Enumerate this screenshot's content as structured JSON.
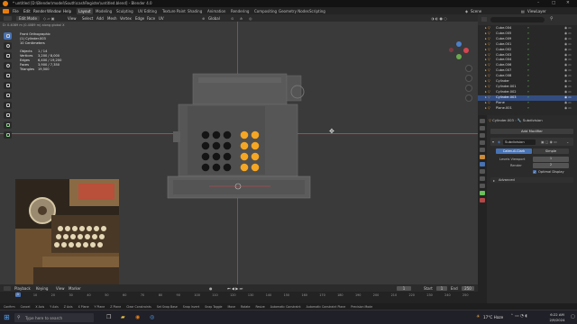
{
  "app": {
    "title": "* untitled [D:\\Blender\\model\\South\\cashRegister\\untitled.blend] - Blender 4.0",
    "window_controls": [
      "–",
      "□",
      "✕"
    ]
  },
  "menu": {
    "items": [
      "File",
      "Edit",
      "Render",
      "Window",
      "Help"
    ],
    "workspaces": [
      "Layout",
      "Modeling",
      "Sculpting",
      "UV Editing",
      "Texture Paint",
      "Shading",
      "Animation",
      "Rendering",
      "Compositing",
      "Geometry Nodes",
      "Scripting"
    ],
    "active_workspace": "Layout",
    "scene": "Scene",
    "view_layer": "ViewLayer"
  },
  "tool_header": {
    "mode": "Edit Mode",
    "menus": [
      "View",
      "Select",
      "Add",
      "Mesh",
      "Vertex",
      "Edge",
      "Face",
      "UV"
    ],
    "transform_orientation": "Global"
  },
  "viewport": {
    "header_status": "D: 0.4089 m (0.4089 m) along global X",
    "view_name": "Front Orthographic",
    "object_name": "(1) Cylinder.003",
    "units": "10 Centimeters",
    "stats": [
      {
        "label": "Objects",
        "value": "1 / 14"
      },
      {
        "label": "Vertices",
        "value": "3,200 / 8,000"
      },
      {
        "label": "Edges",
        "value": "6,400 / 19,200"
      },
      {
        "label": "Faces",
        "value": "3,900 / 7,350"
      },
      {
        "label": "Triangles",
        "value": "19,500"
      }
    ]
  },
  "outliner": {
    "items": [
      {
        "name": "Cube.004",
        "selected": false
      },
      {
        "name": "Cube.005",
        "selected": false
      },
      {
        "name": "Cube.009",
        "selected": false
      },
      {
        "name": "Cube.001",
        "selected": false
      },
      {
        "name": "Cube.002",
        "selected": false
      },
      {
        "name": "Cube.003",
        "selected": false
      },
      {
        "name": "Cube.004",
        "selected": false
      },
      {
        "name": "Cube.006",
        "selected": false
      },
      {
        "name": "Cube.007",
        "selected": false
      },
      {
        "name": "Cube.008",
        "selected": false
      },
      {
        "name": "Cylinder",
        "selected": false
      },
      {
        "name": "Cylinder.001",
        "selected": false
      },
      {
        "name": "Cylinder.002",
        "selected": false
      },
      {
        "name": "Cylinder.003",
        "selected": true
      },
      {
        "name": "Plane",
        "selected": false
      },
      {
        "name": "Plane.001",
        "selected": false
      }
    ]
  },
  "properties": {
    "object_name": "Cylinder.003",
    "modifier_context": "Subdivision",
    "add_modifier": "Add Modifier",
    "modifier_name": "Subdivision",
    "tabs": [
      "Catmull-Clark",
      "Simple"
    ],
    "active_tab": "Catmull-Clark",
    "levels_viewport_label": "Levels Viewport",
    "levels_viewport": "1",
    "render_label": "Render",
    "render": "2",
    "optimal_display": "Optimal Display",
    "advanced": "Advanced"
  },
  "timeline": {
    "menus": [
      "Playback",
      "Keying",
      "View",
      "Marker"
    ],
    "frame_current": "1",
    "start_label": "Start",
    "start": "1",
    "end_label": "End",
    "end": "250",
    "ticks": [
      "0",
      "10",
      "20",
      "30",
      "40",
      "50",
      "60",
      "70",
      "80",
      "90",
      "100",
      "110",
      "120",
      "130",
      "140",
      "150",
      "160",
      "170",
      "180",
      "190",
      "200",
      "210",
      "220",
      "230",
      "240",
      "250"
    ]
  },
  "statusbar": {
    "hints": [
      "Confirm",
      "Cancel",
      "X Axis",
      "Y Axis",
      "Z Axis",
      "X Plane",
      "Y Plane",
      "Z Plane",
      "Clear Constraints",
      "Set Snap Base",
      "Snap Invert",
      "Snap Toggle",
      "Move",
      "Rotate",
      "Resize",
      "Automatic Constraint",
      "Automatic Constraint Plane",
      "Precision Mode"
    ]
  },
  "taskbar": {
    "search_placeholder": "Type here to search",
    "weather": "17°C Haze",
    "time": "6:22 AM",
    "date": "2/9/2024"
  },
  "colors": {
    "accent_blue": "#4772b3",
    "selection_orange": "#f5a623",
    "viewport_bg": "#3a3a3a",
    "x_axis_red": "#d64552"
  }
}
